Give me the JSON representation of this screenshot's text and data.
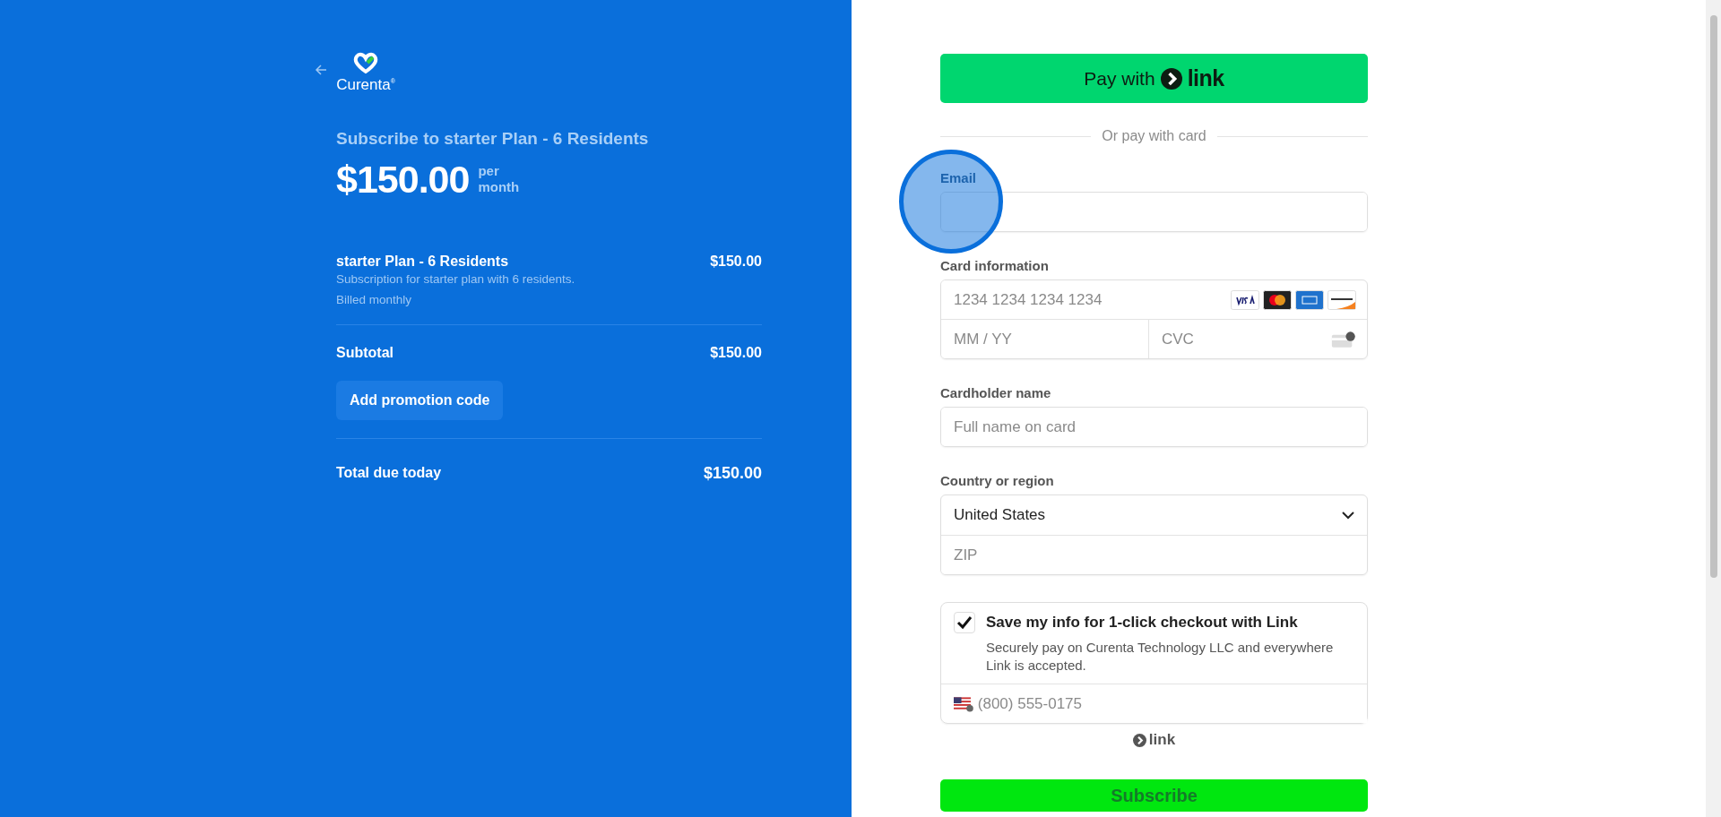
{
  "summary": {
    "logo": {
      "name": "Curenta",
      "mark": "®"
    },
    "title": "Subscribe to starter Plan - 6 Residents",
    "price": "$150.00",
    "period": [
      "per",
      "month"
    ],
    "line_items": [
      {
        "name": "starter Plan - 6 Residents",
        "description": "Subscription for starter plan with 6 residents.",
        "billing": "Billed monthly",
        "amount": "$150.00"
      }
    ],
    "subtotal": {
      "label": "Subtotal",
      "amount": "$150.00"
    },
    "promo_button": "Add promotion code",
    "total": {
      "label": "Total due today",
      "amount": "$150.00"
    }
  },
  "payment": {
    "link_button": {
      "prefix": "Pay with",
      "brand": "link"
    },
    "divider": "Or pay with card",
    "email": {
      "label": "Email",
      "click_indicator": true
    },
    "card": {
      "label": "Card information",
      "number_placeholder": "1234 1234 1234 1234",
      "expiry_placeholder": "MM / YY",
      "cvc_placeholder": "CVC"
    },
    "cardholder": {
      "label": "Cardholder name",
      "placeholder": "Full name on card"
    },
    "country": {
      "label": "Country or region",
      "value": "United States",
      "zip_placeholder": "ZIP"
    },
    "save": {
      "checked": true,
      "title": "Save my info for 1-click checkout with Link",
      "description": "Securely pay on Curenta Technology LLC and everywhere Link is accepted.",
      "phone_placeholder": "(800) 555-0175"
    },
    "footer_brand": "link",
    "subscribe": "Subscribe"
  }
}
